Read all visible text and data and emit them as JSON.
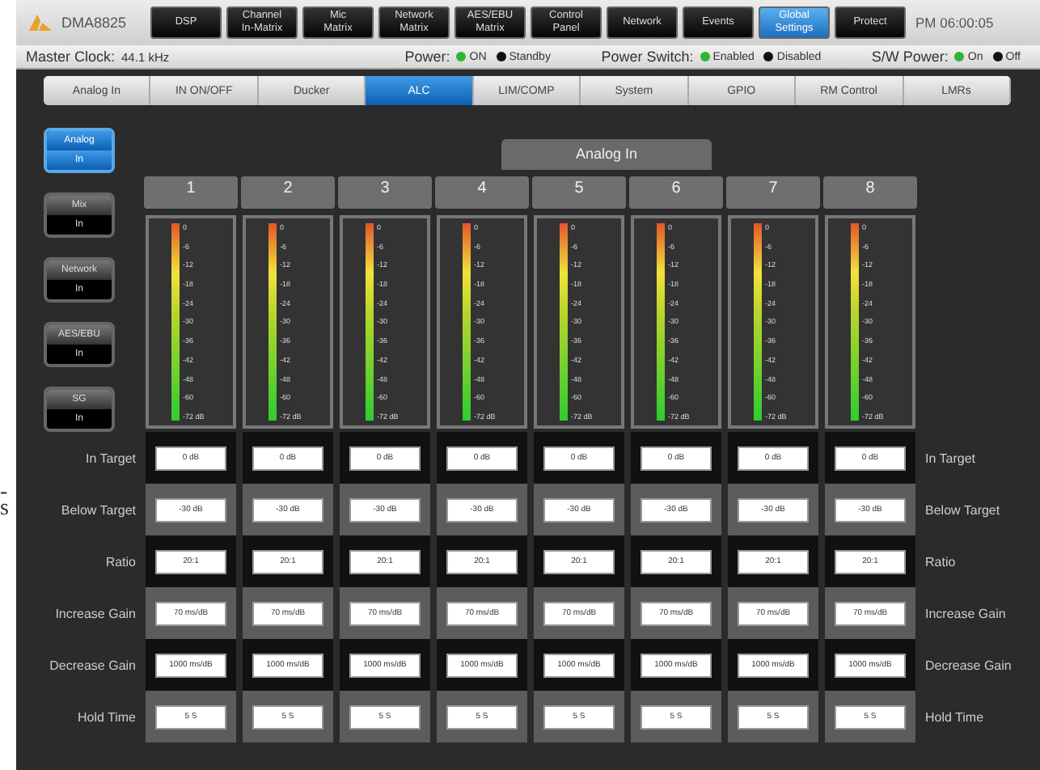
{
  "header": {
    "logo": "DMA8825",
    "time": "PM 06:00:05",
    "tabs": [
      {
        "lines": [
          "DSP"
        ],
        "selected": false
      },
      {
        "lines": [
          "Channel",
          "In-Matrix"
        ],
        "selected": false
      },
      {
        "lines": [
          "Mic",
          "Matrix"
        ],
        "selected": false
      },
      {
        "lines": [
          "Network",
          "Matrix"
        ],
        "selected": false
      },
      {
        "lines": [
          "AES/EBU",
          "Matrix"
        ],
        "selected": false
      },
      {
        "lines": [
          "Control",
          "Panel"
        ],
        "selected": false
      },
      {
        "lines": [
          "Network"
        ],
        "selected": false
      },
      {
        "lines": [
          "Events"
        ],
        "selected": false
      },
      {
        "lines": [
          "Global",
          "Settings"
        ],
        "selected": true
      },
      {
        "lines": [
          "Protect"
        ],
        "selected": false
      }
    ]
  },
  "status_bar": {
    "clock_label": "Master Clock:",
    "clock_value": "44.1 kHz",
    "groups": [
      {
        "label": "Power:",
        "options": [
          {
            "label": "ON",
            "selected": true
          },
          {
            "label": "Standby",
            "selected": false
          }
        ]
      },
      {
        "label": "Power Switch:",
        "options": [
          {
            "label": "Enabled",
            "selected": true
          },
          {
            "label": "Disabled",
            "selected": false
          }
        ]
      },
      {
        "label": "S/W Power:",
        "options": [
          {
            "label": "On",
            "selected": true
          },
          {
            "label": "Off",
            "selected": false
          }
        ]
      }
    ]
  },
  "subtabs": [
    {
      "label": "Analog In",
      "selected": false
    },
    {
      "label": "IN ON/OFF",
      "selected": false
    },
    {
      "label": "Ducker",
      "selected": false
    },
    {
      "label": "ALC",
      "selected": true
    },
    {
      "label": "LIM/COMP",
      "selected": false
    },
    {
      "label": "System",
      "selected": false
    },
    {
      "label": "GPIO",
      "selected": false
    },
    {
      "label": "RM Control",
      "selected": false
    },
    {
      "label": "LMRs",
      "selected": false
    }
  ],
  "sources": [
    {
      "lines": [
        "Analog",
        "In"
      ],
      "selected": true
    },
    {
      "lines": [
        "Mix",
        "In"
      ],
      "selected": false
    },
    {
      "lines": [
        "Network",
        "In"
      ],
      "selected": false
    },
    {
      "lines": [
        "AES/EBU",
        "In"
      ],
      "selected": false
    },
    {
      "lines": [
        "SG",
        "In"
      ],
      "selected": false
    }
  ],
  "panel": {
    "title": "Analog In",
    "channels": [
      {
        "label": "1",
        "level": 1,
        "scale": [
          "0",
          "-6",
          "-12",
          "-18",
          "-24",
          "-30",
          "-36",
          "-42",
          "-48",
          "-60",
          "-72 dB"
        ]
      },
      {
        "label": "2",
        "level": 1,
        "scale": [
          "0",
          "-6",
          "-12",
          "-18",
          "-24",
          "-30",
          "-36",
          "-42",
          "-48",
          "-60",
          "-72 dB"
        ]
      },
      {
        "label": "3",
        "level": 1,
        "scale": [
          "0",
          "-6",
          "-12",
          "-18",
          "-24",
          "-30",
          "-36",
          "-42",
          "-48",
          "-60",
          "-72 dB"
        ]
      },
      {
        "label": "4",
        "level": 1,
        "scale": [
          "0",
          "-6",
          "-12",
          "-18",
          "-24",
          "-30",
          "-36",
          "-42",
          "-48",
          "-60",
          "-72 dB"
        ]
      },
      {
        "label": "5",
        "level": 1,
        "scale": [
          "0",
          "-6",
          "-12",
          "-18",
          "-24",
          "-30",
          "-36",
          "-42",
          "-48",
          "-60",
          "-72 dB"
        ]
      },
      {
        "label": "6",
        "level": 1,
        "scale": [
          "0",
          "-6",
          "-12",
          "-18",
          "-24",
          "-30",
          "-36",
          "-42",
          "-48",
          "-60",
          "-72 dB"
        ]
      },
      {
        "label": "7",
        "level": 1,
        "scale": [
          "0",
          "-6",
          "-12",
          "-18",
          "-24",
          "-30",
          "-36",
          "-42",
          "-48",
          "-60",
          "-72 dB"
        ]
      },
      {
        "label": "8",
        "level": 1,
        "scale": [
          "0",
          "-6",
          "-12",
          "-18",
          "-24",
          "-30",
          "-36",
          "-42",
          "-48",
          "-60",
          "-72 dB"
        ]
      }
    ],
    "params": [
      {
        "label": "In Target",
        "label_right": "In Target",
        "values": [
          "0 dB",
          "0 dB",
          "0 dB",
          "0 dB",
          "0 dB",
          "0 dB",
          "0 dB",
          "0 dB"
        ]
      },
      {
        "label": "Below Target",
        "label_right": "Below Target",
        "values": [
          "-30 dB",
          "-30 dB",
          "-30 dB",
          "-30 dB",
          "-30 dB",
          "-30 dB",
          "-30 dB",
          "-30 dB"
        ]
      },
      {
        "label": "Ratio",
        "label_right": "Ratio",
        "values": [
          "20:1",
          "20:1",
          "20:1",
          "20:1",
          "20:1",
          "20:1",
          "20:1",
          "20:1"
        ]
      },
      {
        "label": "Increase Gain",
        "label_right": "Increase Gain",
        "values": [
          "70 ms/dB",
          "70 ms/dB",
          "70 ms/dB",
          "70 ms/dB",
          "70 ms/dB",
          "70 ms/dB",
          "70 ms/dB",
          "70 ms/dB"
        ]
      },
      {
        "label": "Decrease Gain",
        "label_right": "Decrease Gain",
        "values": [
          "1000 ms/dB",
          "1000 ms/dB",
          "1000 ms/dB",
          "1000 ms/dB",
          "1000 ms/dB",
          "1000 ms/dB",
          "1000 ms/dB",
          "1000 ms/dB"
        ]
      },
      {
        "label": "Hold Time",
        "label_right": "Hold Time",
        "values": [
          "5 S",
          "5 S",
          "5 S",
          "5 S",
          "5 S",
          "5 S",
          "5 S",
          "5 S"
        ]
      }
    ]
  },
  "margin_text": [
    "-",
    "s"
  ]
}
